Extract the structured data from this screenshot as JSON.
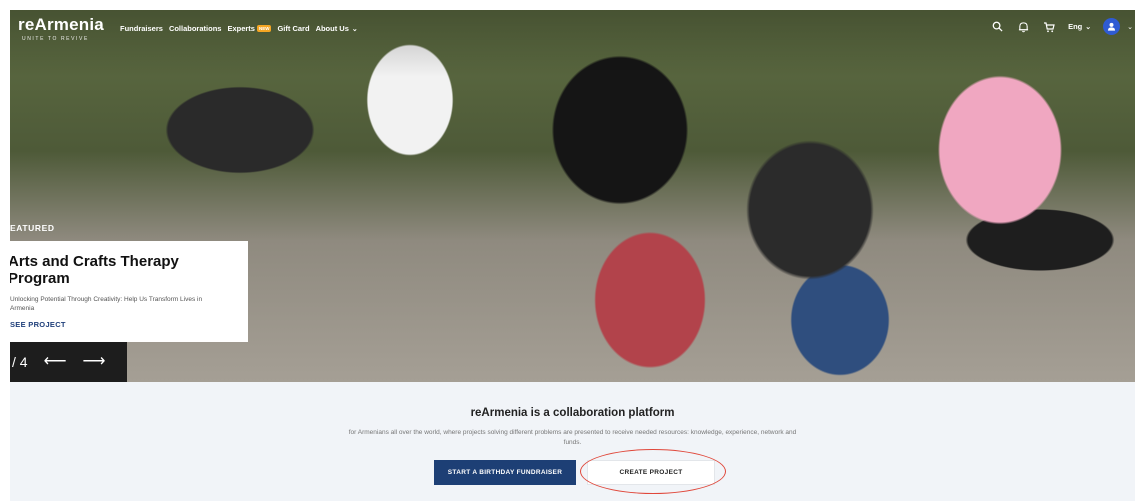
{
  "nav": {
    "logo_main": "reArmenia",
    "logo_sub": "UNITE TO REVIVE",
    "links": [
      {
        "label": "Fundraisers"
      },
      {
        "label": "Collaborations"
      },
      {
        "label": "Experts",
        "badge": "NEW"
      },
      {
        "label": "Gift Card"
      },
      {
        "label": "About Us"
      }
    ],
    "language": "Eng",
    "icons": [
      "search-icon",
      "bell-icon",
      "cart-icon",
      "user-icon",
      "chevron-down-icon"
    ]
  },
  "hero": {
    "featured_label": "EATURED",
    "title": "Arts and Crafts Therapy Program",
    "description": "Unlocking Potential Through Creativity: Help Us Transform Lives in Armenia",
    "link_label": "SEE PROJECT",
    "pager": "/ 4"
  },
  "info": {
    "title": "reArmenia is a collaboration platform",
    "description": "for Armenians all over the world, where projects solving different problems are presented to receive needed resources: knowledge, experience, network and funds.",
    "primary_button": "START A BIRTHDAY FUNDRAISER",
    "secondary_button": "CREATE PROJECT"
  },
  "colors": {
    "brand_navy": "#1d3f75",
    "avatar_blue": "#2f5bd3",
    "new_badge": "#f5a623",
    "annotation_red": "#e0473a",
    "section_bg": "#f1f4f8"
  }
}
